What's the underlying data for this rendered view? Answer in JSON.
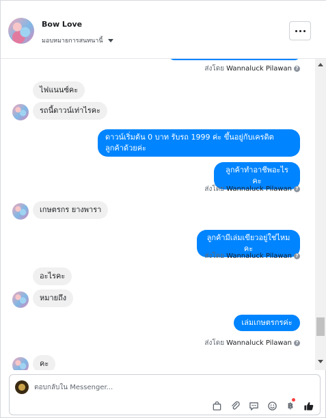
{
  "header": {
    "contact_name": "Bow Love",
    "assign_label": "มอบหมายการสนทนานี้"
  },
  "messages": {
    "top_sent_by_prefix": "ส่งโดย",
    "top_sent_by_name": "Wannaluck Pilawan",
    "in_1": "ไฟแนนซ์คะ",
    "in_2": "รถนี้ดาวน์เท่าไรคะ",
    "out_1": "ดาวน์เริ่มต้น 0 บาท รับรถ 1999 ค่ะ  ขึ้นอยู่กับเครดิต ลูกค้าด้วยค่ะ",
    "out_2": "ลูกค้าทำอาชีพอะไรคะ",
    "sent_by_prefix": "ส่งโดย",
    "sent_by_name": "Wannaluck Pilawan",
    "in_3": "เกษตรกร ยางพารา",
    "out_3": "ลูกค้ามีเล่มเขียวอยู่ใช่ไหมคะ",
    "in_4": "อะไรคะ",
    "in_5": "หมายถึง",
    "out_4": "เล่มเกษตรกรค่ะ",
    "in_6": "คะ"
  },
  "composer": {
    "placeholder": "ตอบกลับใน Messenger...",
    "currency_symbol": "฿"
  },
  "colors": {
    "outgoing_bubble": "#0084ff",
    "incoming_bubble": "#f0f0f0",
    "like": "#1c1e21"
  }
}
